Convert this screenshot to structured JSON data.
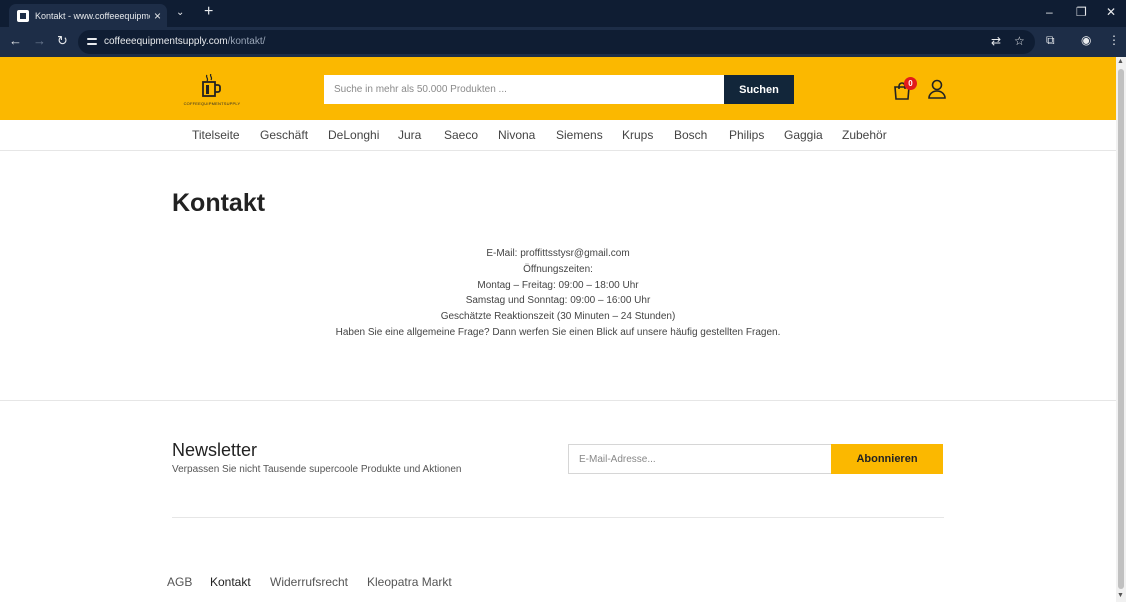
{
  "browser": {
    "tab_title": "Kontakt - www.coffeeequipmentsupply.com",
    "url_host": "coffeeequipmentsupply.com",
    "url_path": "/kontakt/"
  },
  "header": {
    "logo_text": "COFFEEQUIPMENTSUPPLY",
    "search_placeholder": "Suche in mehr als 50.000 Produkten ...",
    "search_button": "Suchen",
    "cart_count": "0",
    "accent_color": "#fbb800",
    "button_color": "#12263a"
  },
  "nav": {
    "items": [
      "Titelseite",
      "Geschäft",
      "DeLonghi",
      "Jura",
      "Saeco",
      "Nivona",
      "Siemens",
      "Krups",
      "Bosch",
      "Philips",
      "Gaggia",
      "Zubehör"
    ]
  },
  "page": {
    "title": "Kontakt",
    "lines": [
      "E-Mail: proffittsstysr@gmail.com",
      "Öffnungszeiten:",
      "Montag – Freitag: 09:00 – 18:00 Uhr",
      "Samstag und Sonntag: 09:00 – 16:00 Uhr",
      "Geschätzte Reaktionszeit (30 Minuten – 24 Stunden)",
      "Haben Sie eine allgemeine Frage? Dann werfen Sie einen Blick auf unsere häufig gestellten Fragen."
    ]
  },
  "newsletter": {
    "title": "Newsletter",
    "subtitle": "Verpassen Sie nicht Tausende supercoole Produkte und Aktionen",
    "email_placeholder": "E-Mail-Adresse...",
    "button": "Abonnieren"
  },
  "footer": {
    "links": [
      "AGB",
      "Kontakt",
      "Widerrufsrecht",
      "Kleopatra Markt"
    ]
  }
}
